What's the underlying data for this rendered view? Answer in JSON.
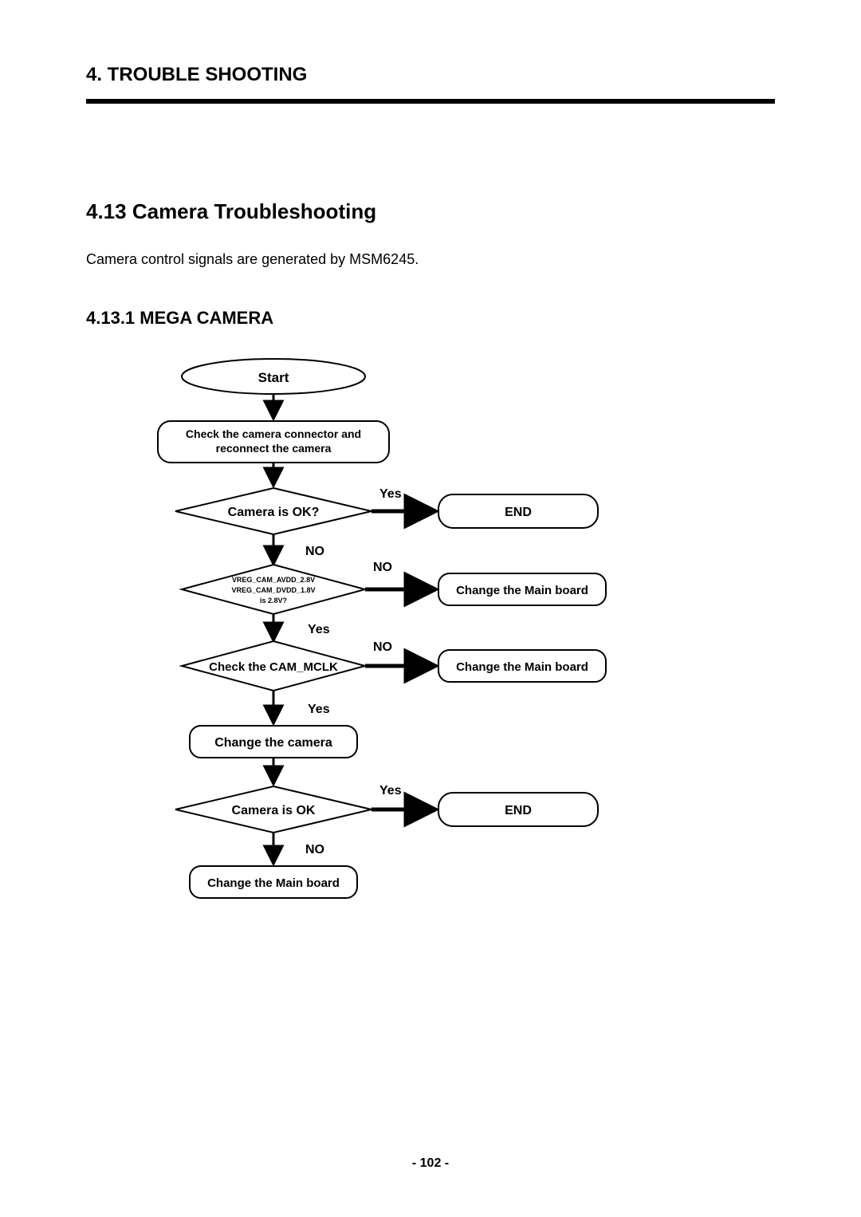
{
  "chapter_title": "4. TROUBLE SHOOTING",
  "section_title": "4.13 Camera Troubleshooting",
  "body_text": "Camera control signals are generated by MSM6245.",
  "subsection_title": "4.13.1 MEGA CAMERA",
  "flow": {
    "start": "Start",
    "step1": "Check the camera connector and",
    "step1b": "reconnect the camera",
    "d1": "Camera is OK?",
    "d1_yes": "Yes",
    "d1_no": "NO",
    "end1": "END",
    "d2a": "VREG_CAM_AVDD_2.8V",
    "d2b": "VREG_CAM_DVDD_1.8V",
    "d2c": "is 2.8V?",
    "d2_yes": "Yes",
    "d2_no": "NO",
    "change_main_1": "Change the Main board",
    "d3": "Check the CAM_MCLK",
    "d3_yes": "Yes",
    "d3_no": "NO",
    "change_main_2": "Change the Main board",
    "step2": "Change the camera",
    "d4": "Camera is OK",
    "d4_yes": "Yes",
    "d4_no": "NO",
    "end2": "END",
    "step3": "Change the Main board"
  },
  "page_number": "- 102 -"
}
